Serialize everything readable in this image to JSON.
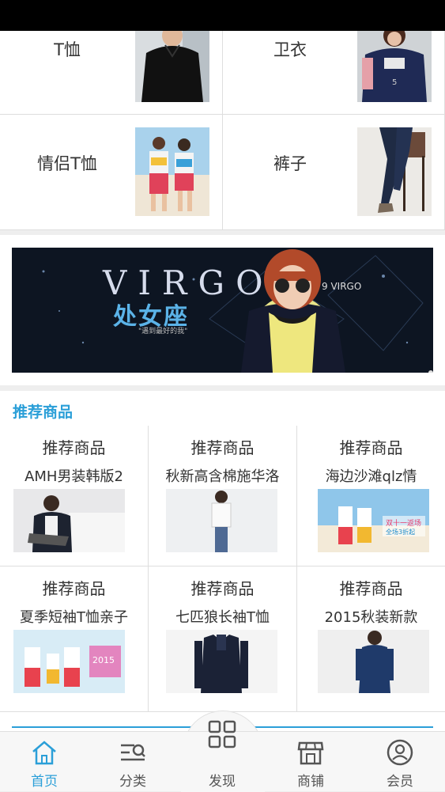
{
  "categories": [
    {
      "label": "T恤",
      "image": "black-tshirt-photo"
    },
    {
      "label": "卫衣",
      "image": "navy-sweatshirt-photo"
    },
    {
      "label": "情侣T恤",
      "image": "couple-tshirt-photo"
    },
    {
      "label": "裤子",
      "image": "jeans-photo"
    }
  ],
  "banner": {
    "title": "VIRGO",
    "subtitle_cn": "处女座",
    "tagline": "\"遇到最好的我\"",
    "small_mark": "9 VIRGO",
    "slides": 2,
    "active_slide": 1
  },
  "recommend": {
    "title": "推荐商品",
    "items": [
      {
        "heading": "推荐商品",
        "name": "AMH男装韩版2",
        "image": "man-sitting-photo"
      },
      {
        "heading": "推荐商品",
        "name": "秋新高含棉施华洛",
        "image": "woman-white-tee-photo"
      },
      {
        "heading": "推荐商品",
        "name": "海边沙滩qlz情",
        "image": "beach-couple-photo"
      },
      {
        "heading": "推荐商品",
        "name": "夏季短袖T恤亲子",
        "image": "family-tshirt-photo"
      },
      {
        "heading": "推荐商品",
        "name": "七匹狼长袖T恤",
        "image": "navy-polo-photo"
      },
      {
        "heading": "推荐商品",
        "name": "2015秋装新款",
        "image": "woman-denim-top-photo"
      }
    ]
  },
  "tabs": [
    {
      "label": "首页",
      "icon": "home-icon",
      "active": true
    },
    {
      "label": "分类",
      "icon": "category-icon",
      "active": false
    },
    {
      "label": "发现",
      "icon": "discover-icon",
      "active": false
    },
    {
      "label": "商铺",
      "icon": "shop-icon",
      "active": false
    },
    {
      "label": "会员",
      "icon": "member-icon",
      "active": false
    }
  ],
  "colors": {
    "accent": "#2b9fd8",
    "tab_active": "#2b9fd8"
  }
}
